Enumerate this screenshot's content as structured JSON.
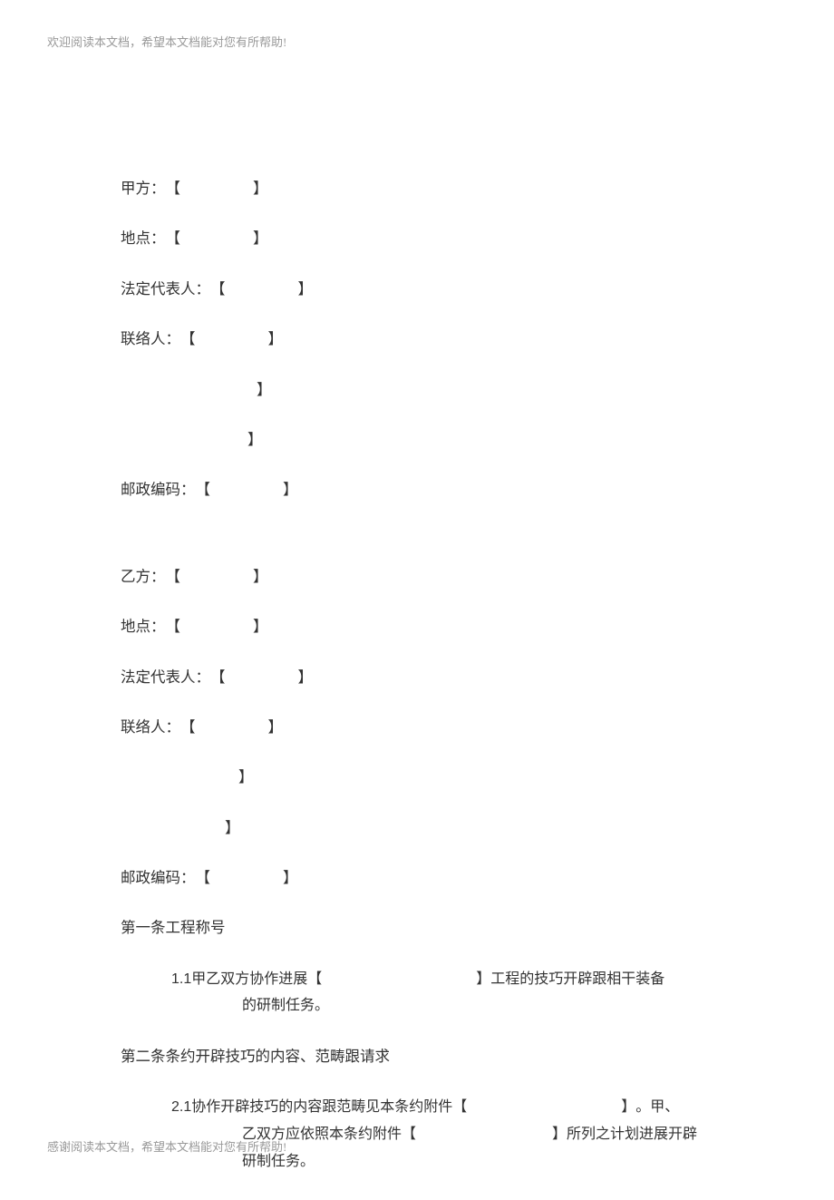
{
  "header": "欢迎阅读本文档，希望本文档能对您有所帮助!",
  "footer": "感谢阅读本文档，希望本文档能对您有所帮助!",
  "bracket_open": "【",
  "bracket_close": "】",
  "partyA": {
    "label_party": "甲方：",
    "label_address": "地点：",
    "label_legal": "法定代表人：",
    "label_contact": "联络人：",
    "label_postal": "邮政编码："
  },
  "partyB": {
    "label_party": "乙方：",
    "label_address": "地点：",
    "label_legal": "法定代表人：",
    "label_contact": "联络人：",
    "label_postal": "邮政编码："
  },
  "article1": {
    "title": "第一条工程称号",
    "clause_num": "1.1",
    "clause_part1": "甲乙双方协作进展",
    "clause_part2": "工程的技巧开辟跟相干装备",
    "clause_line2": "的研制任务。"
  },
  "article2": {
    "title": "第二条条约开辟技巧的内容、范畴跟请求",
    "clause_num": "2.1",
    "clause_part1": "协作开辟技巧的内容跟范畴见本条约附件",
    "clause_part2": "。甲、",
    "clause_line2a": "乙双方应依照本条约附件",
    "clause_line2b": "所列之计划进展开辟",
    "clause_line3": "研制任务。"
  }
}
